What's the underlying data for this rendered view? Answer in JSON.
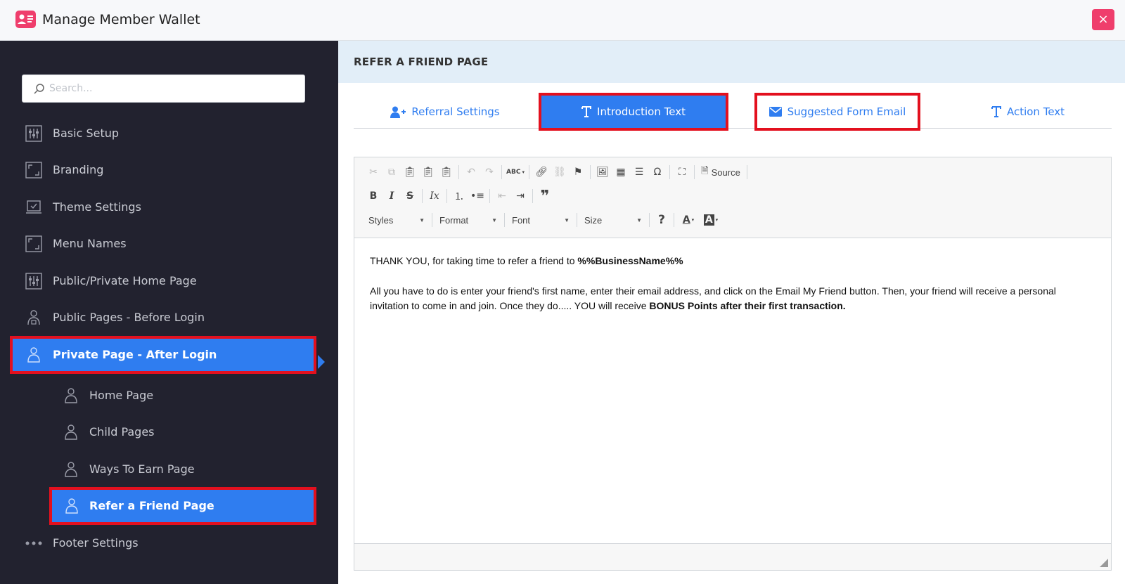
{
  "header": {
    "title": "Manage Member Wallet",
    "close_label": "×",
    "accent_color": "#ef3e6c"
  },
  "sidebar": {
    "search_placeholder": "Search...",
    "items": [
      {
        "label": "Basic Setup",
        "icon": "sliders-icon"
      },
      {
        "label": "Branding",
        "icon": "frame-icon"
      },
      {
        "label": "Theme Settings",
        "icon": "monitor-check-icon"
      },
      {
        "label": "Menu Names",
        "icon": "frame-icon"
      },
      {
        "label": "Public/Private Home Page",
        "icon": "sliders-icon"
      },
      {
        "label": "Public Pages - Before Login",
        "icon": "user-lock-icon"
      },
      {
        "label": "Private Page - After Login",
        "icon": "user-icon",
        "active": true
      },
      {
        "label": "Home Page",
        "icon": "user-icon",
        "sub": true
      },
      {
        "label": "Child Pages",
        "icon": "user-icon",
        "sub": true
      },
      {
        "label": "Ways To Earn Page",
        "icon": "user-icon",
        "sub": true
      },
      {
        "label": "Refer a Friend Page",
        "icon": "user-icon",
        "sub": true,
        "active": true
      },
      {
        "label": "Footer Settings",
        "icon": "dots-icon"
      }
    ],
    "active_color": "#2f7df0",
    "background_color": "#22222f"
  },
  "main": {
    "title": "REFER A FRIEND PAGE",
    "tabs": [
      {
        "label": "Referral Settings",
        "icon": "user-plus-icon"
      },
      {
        "label": "Introduction Text",
        "icon": "text-icon",
        "active": true
      },
      {
        "label": "Suggested Form Email",
        "icon": "envelope-icon"
      },
      {
        "label": "Action Text",
        "icon": "text-icon"
      }
    ],
    "editor": {
      "source_label": "Source",
      "styles_label": "Styles",
      "format_label": "Format",
      "font_label": "Font",
      "size_label": "Size",
      "paragraph1_text": "THANK YOU, for taking time to refer a friend to ",
      "paragraph1_bold": "%%BusinessName%%",
      "paragraph2_text": "All you have to do is enter your friend's first name, enter their email address, and click on the Email My Friend button. Then, your friend will receive a personal invitation to come in and join. Once they do..... YOU will receive ",
      "paragraph2_bold": "BONUS Points after their first transaction."
    }
  }
}
